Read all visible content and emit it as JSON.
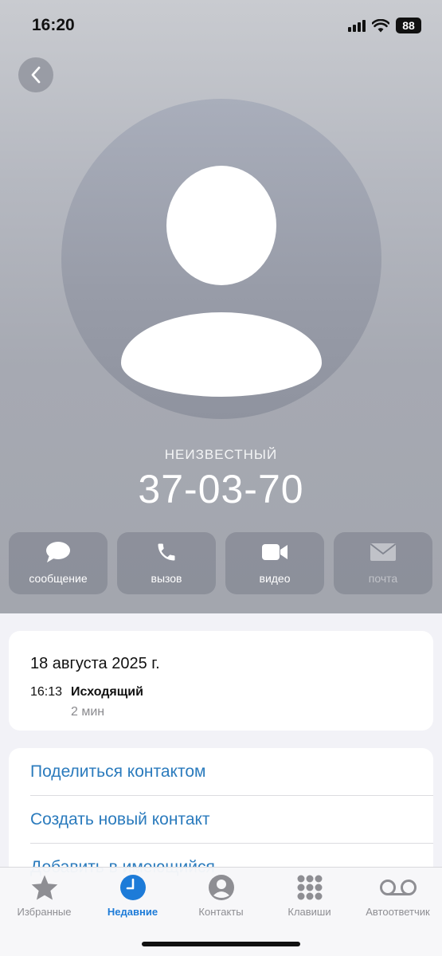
{
  "status_bar": {
    "time": "16:20",
    "battery": "88"
  },
  "caller": {
    "label": "НЕИЗВЕСТНЫЙ",
    "number": "37-03-70"
  },
  "actions": [
    {
      "label": "сообщение",
      "icon": "message-icon",
      "enabled": true
    },
    {
      "label": "вызов",
      "icon": "phone-icon",
      "enabled": true
    },
    {
      "label": "видео",
      "icon": "video-icon",
      "enabled": true
    },
    {
      "label": "почта",
      "icon": "mail-icon",
      "enabled": false
    }
  ],
  "call_log": {
    "date": "18 августа 2025 г.",
    "entries": [
      {
        "time": "16:13",
        "type": "Исходящий",
        "duration": "2 мин"
      }
    ]
  },
  "options": [
    "Поделиться контактом",
    "Создать новый контакт",
    "Добавить в имеющийся"
  ],
  "tabs": [
    {
      "label": "Избранные",
      "icon": "star-icon",
      "active": false
    },
    {
      "label": "Недавние",
      "icon": "clock-icon",
      "active": true
    },
    {
      "label": "Контакты",
      "icon": "person-circle-icon",
      "active": false
    },
    {
      "label": "Клавиши",
      "icon": "keypad-icon",
      "active": false
    },
    {
      "label": "Автоответчик",
      "icon": "voicemail-icon",
      "active": false
    }
  ],
  "colors": {
    "accent": "#1d7bd8",
    "link": "#2b7bbd",
    "inactive_tab": "#8e8e93"
  }
}
